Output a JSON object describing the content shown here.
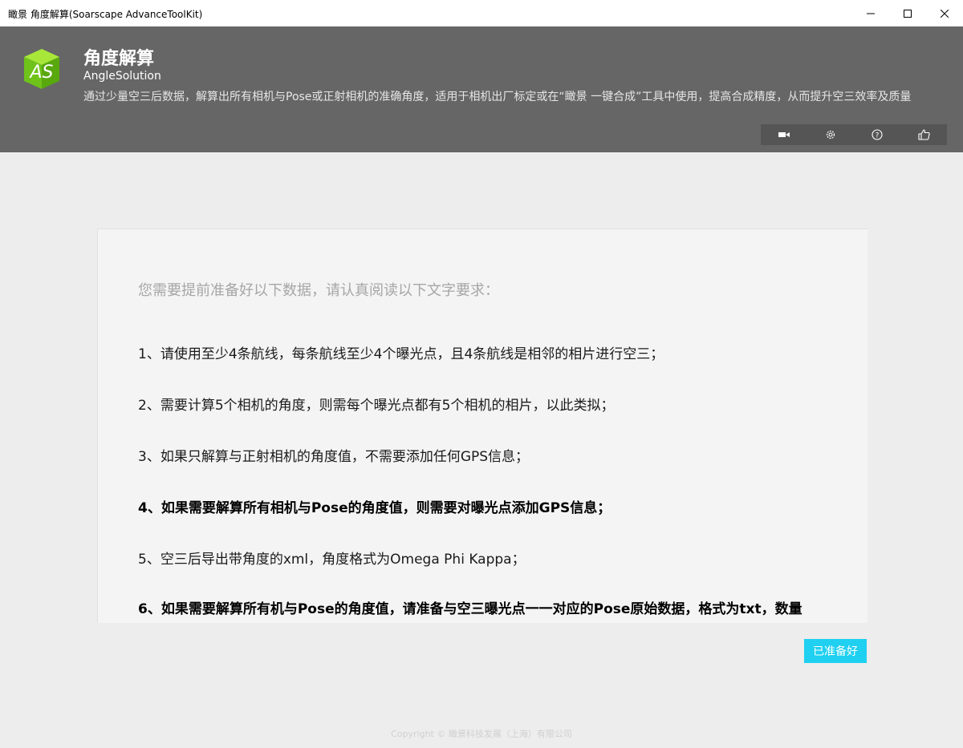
{
  "window": {
    "title": "瞰景 角度解算(Soarscape AdvanceToolKit)"
  },
  "header": {
    "logo_text": "AS",
    "title": "角度解算",
    "subtitle": "AngleSolution",
    "description": "通过少量空三后数据，解算出所有相机与Pose或正射相机的准确角度，适用于相机出厂标定或在“瞰景 一键合成”工具中使用，提高合成精度，从而提升空三效率及质量",
    "toolbar_icons": [
      "video-icon",
      "gear-icon",
      "help-icon",
      "thumbs-up-icon"
    ]
  },
  "card": {
    "heading": "您需要提前准备好以下数据，请认真阅读以下文字要求：",
    "items": [
      {
        "text": "1、请使用至少4条航线，每条航线至少4个曝光点，且4条航线是相邻的相片进行空三；",
        "bold": false
      },
      {
        "text": "2、需要计算5个相机的角度，则需每个曝光点都有5个相机的相片，以此类拟；",
        "bold": false
      },
      {
        "text": "3、如果只解算与正射相机的角度值，不需要添加任何GPS信息；",
        "bold": false
      },
      {
        "text": "4、如果需要解算所有相机与Pose的角度值，则需要对曝光点添加GPS信息；",
        "bold": true
      },
      {
        "text": "5、空三后导出带角度的xml，角度格式为Omega Phi Kappa；",
        "bold": false
      },
      {
        "text": "6、如果需要解算所有机与Pose的角度值，请准备与空三曝光点一一对应的Pose原始数据，格式为txt，数量",
        "bold": true
      }
    ]
  },
  "actions": {
    "ready_label": "已准备好"
  },
  "footer": {
    "copyright": "Copyright © 瞰景科技发展（上海）有限公司"
  },
  "colors": {
    "header_bg": "#666666",
    "accent": "#1fd0f0",
    "logo_green": "#7ed321"
  }
}
